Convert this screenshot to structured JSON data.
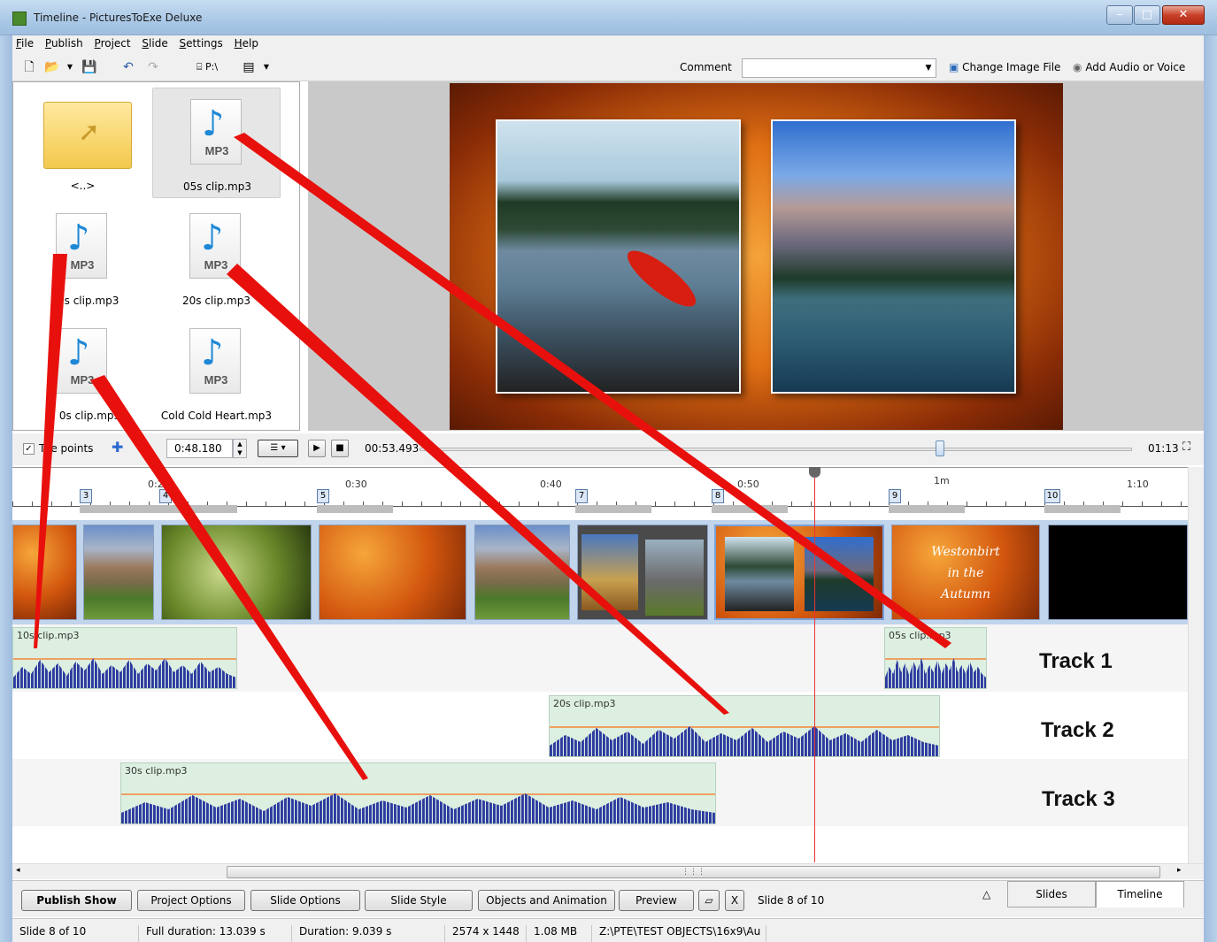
{
  "window": {
    "title": "Timeline - PicturesToExe Deluxe"
  },
  "menu": [
    "File",
    "Publish",
    "Project",
    "Slide",
    "Settings",
    "Help"
  ],
  "toolbar": {
    "drive_label": "P:\\",
    "comment_label": "Comment",
    "comment_value": "",
    "change_image": "Change Image File",
    "add_audio": "Add Audio or Voice"
  },
  "files": [
    {
      "name": "<..>",
      "type": "folder",
      "selected": false
    },
    {
      "name": "05s clip.mp3",
      "type": "mp3",
      "selected": true
    },
    {
      "name": "s clip.mp3",
      "type": "mp3",
      "selected": false
    },
    {
      "name": "20s clip.mp3",
      "type": "mp3",
      "selected": false
    },
    {
      "name": "0s clip.mp3",
      "type": "mp3",
      "selected": false
    },
    {
      "name": "Cold Cold Heart.mp3",
      "type": "mp3",
      "selected": false
    }
  ],
  "file_icon_label": "MP3",
  "playback": {
    "time_points_label": "e points",
    "time_points_prefix": "T",
    "time_value": "0:48.180",
    "position": "00:53.493",
    "duration": "01:13",
    "slider_fraction": 0.73
  },
  "ruler": {
    "ticks": [
      {
        "label": "0:2",
        "pos": "0:20"
      },
      {
        "label": "0:30",
        "pos": "0:30"
      },
      {
        "label": "0:40",
        "pos": "0:40"
      },
      {
        "label": "0:50",
        "pos": "0:50"
      },
      {
        "label": "1m",
        "pos": "1:00"
      },
      {
        "label": "1:10",
        "pos": "1:10"
      }
    ],
    "slide_markers": [
      "3",
      "4",
      "5",
      "7",
      "8",
      "9",
      "10"
    ]
  },
  "tracks": [
    {
      "label": "Track 1",
      "clips": [
        "10s clip.mp3",
        "05s clip.mp3"
      ]
    },
    {
      "label": "Track 2",
      "clips": [
        "20s clip.mp3"
      ]
    },
    {
      "label": "Track 3",
      "clips": [
        "30s clip.mp3"
      ]
    }
  ],
  "thumb_text": [
    "Westonbirt",
    "in the",
    "Autumn"
  ],
  "bottom": {
    "publish": "Publish Show",
    "project_options": "Project Options",
    "slide_options": "Slide Options",
    "slide_style": "Slide Style",
    "objects": "Objects and Animation",
    "preview": "Preview",
    "x": "X",
    "slide_of": "Slide 8 of 10",
    "tab_slides": "Slides",
    "tab_timeline": "Timeline"
  },
  "status": {
    "slide": "Slide 8 of 10",
    "full_duration": "Full duration: 13.039 s",
    "duration": "Duration: 9.039 s",
    "resolution": "2574 x 1448",
    "size": "1.08 MB",
    "path": "Z:\\PTE\\TEST OBJECTS\\16x9\\Au"
  },
  "colors": {
    "annotation": "#e8100c",
    "accent": "#3d4db2",
    "clip_fill": "#dcefe0"
  }
}
